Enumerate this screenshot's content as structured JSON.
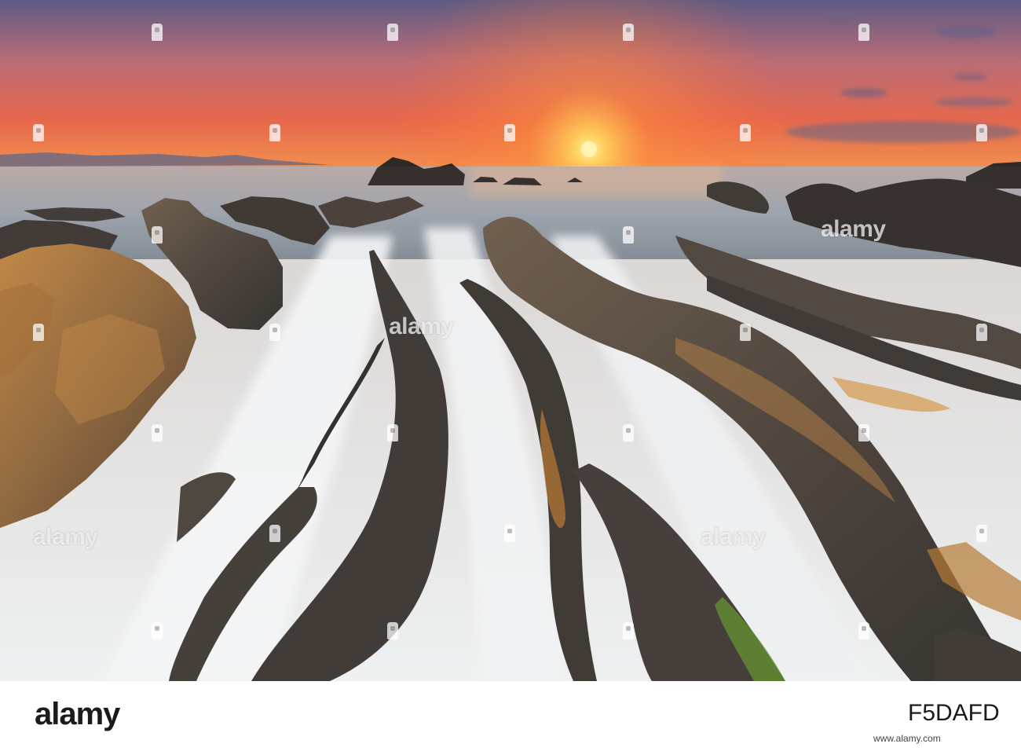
{
  "image": {
    "description_tag": "sunset-over-rocky-flysch-coastline",
    "colors": {
      "sky_top": "#5b5e86",
      "sky_mid": "#e46a4f",
      "sky_horizon": "#f3a055",
      "sun": "#ffd86a",
      "sea": "#9aa3ad",
      "water_streak": "#e7ebee",
      "rock_dark": "#3e3a35",
      "rock_orange": "#b9762f",
      "moss": "#5a8a2a"
    }
  },
  "watermark": {
    "text": "alamy"
  },
  "footer": {
    "brand": "alamy",
    "image_id": "F5DAFD",
    "url": "www.alamy.com"
  }
}
